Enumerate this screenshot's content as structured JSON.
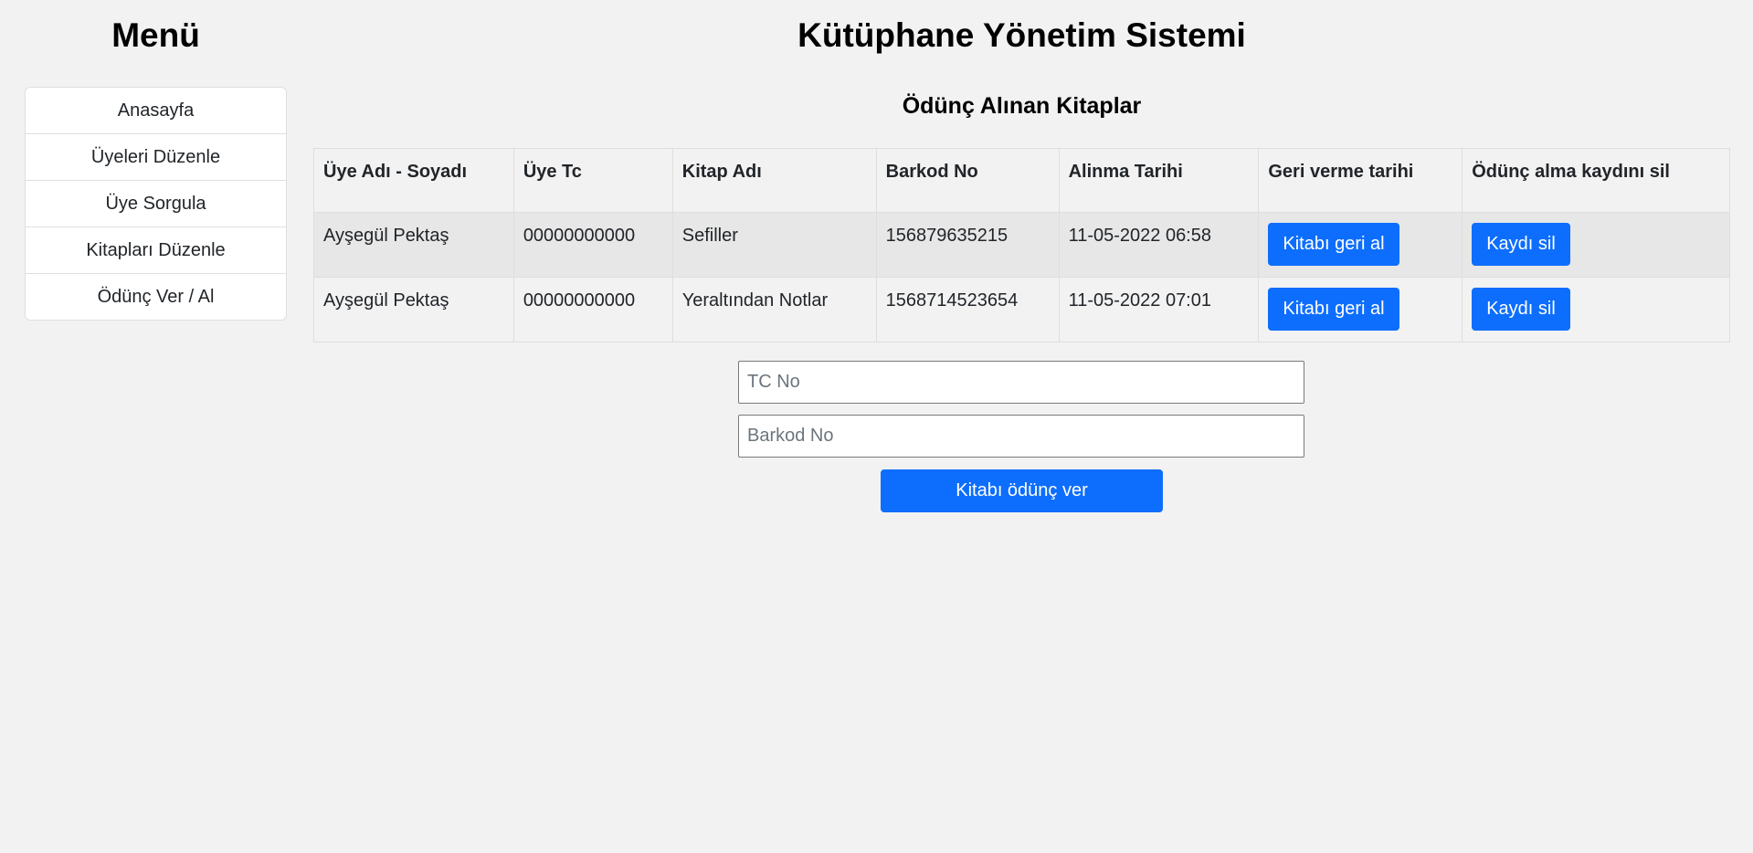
{
  "sidebar": {
    "title": "Menü",
    "items": [
      {
        "label": "Anasayfa"
      },
      {
        "label": "Üyeleri Düzenle"
      },
      {
        "label": "Üye Sorgula"
      },
      {
        "label": "Kitapları Düzenle"
      },
      {
        "label": "Ödünç Ver / Al"
      }
    ]
  },
  "header": {
    "title": "Kütüphane Yönetim Sistemi"
  },
  "loans": {
    "title": "Ödünç Alınan Kitaplar",
    "columns": [
      "Üye Adı - Soyadı",
      "Üye Tc",
      "Kitap Adı",
      "Barkod No",
      "Alinma Tarihi",
      "Geri verme tarihi",
      "Ödünç alma kaydını sil"
    ],
    "rows": [
      {
        "member_name": "Ayşegül Pektaş",
        "tc": "00000000000",
        "book": "Sefiller",
        "barcode": "156879635215",
        "date": "11-05-2022 06:58",
        "return_label": "Kitabı geri al",
        "delete_label": "Kaydı sil"
      },
      {
        "member_name": "Ayşegül Pektaş",
        "tc": "00000000000",
        "book": "Yeraltından Notlar",
        "barcode": "1568714523654",
        "date": "11-05-2022 07:01",
        "return_label": "Kitabı geri al",
        "delete_label": "Kaydı sil"
      }
    ]
  },
  "form": {
    "tc_placeholder": "TC No",
    "tc_value": "",
    "barcode_placeholder": "Barkod No",
    "barcode_value": "",
    "submit_label": "Kitabı ödünç ver"
  },
  "colors": {
    "background": "#f2f2f2",
    "primary": "#0d6efd",
    "stripe": "#e7e7e7"
  }
}
